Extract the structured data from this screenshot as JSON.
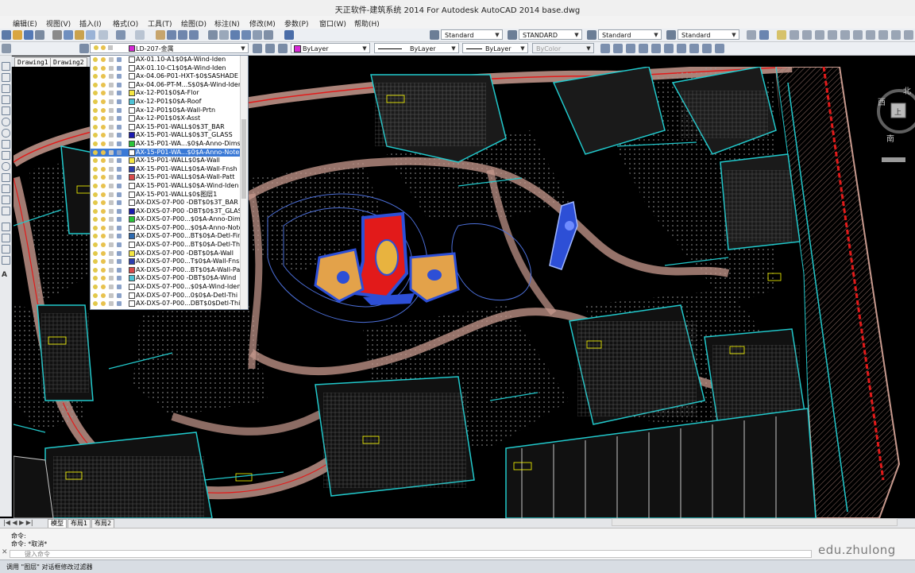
{
  "app": {
    "title": "天正软件-建筑系统 2014  For Autodesk AutoCAD 2014      base.dwg"
  },
  "menu": [
    "编辑(E)",
    "视图(V)",
    "插入(I)",
    "格式(O)",
    "工具(T)",
    "绘图(D)",
    "标注(N)",
    "修改(M)",
    "参数(P)",
    "窗口(W)",
    "帮助(H)"
  ],
  "styles": {
    "text_style": "Standard",
    "dim_style": "STANDARD",
    "table_style": "Standard",
    "multileader_style": "Standard"
  },
  "properties": {
    "current_layer": "LD-207-金属",
    "color": "ByLayer",
    "linetype": "ByLayer",
    "lineweight": "ByLayer",
    "plot_style": "ByColor"
  },
  "doc_tabs": [
    "Drawing1",
    "Drawing2"
  ],
  "layers": [
    {
      "name": "AX-01.10-A1$0$A-Wind-Iden",
      "swatch": "#ffffff"
    },
    {
      "name": "AX-01.10-C1$0$A-Wind-Iden",
      "swatch": "#ffffff"
    },
    {
      "name": "Ax-04.06-P01-HXT-$0$SASHADE",
      "swatch": "#ffffff"
    },
    {
      "name": "Ax-04.06-PT-M...S$0$A-Wind-Iden",
      "swatch": "#ffffff"
    },
    {
      "name": "Ax-12-P01$0$A-Flor",
      "swatch": "#f5e642"
    },
    {
      "name": "Ax-12-P01$0$A-Roof",
      "swatch": "#4ec3d6"
    },
    {
      "name": "Ax-12-P01$0$A-Wall-Prtn",
      "swatch": "#ffffff"
    },
    {
      "name": "Ax-12-P01$0$X-Asst",
      "swatch": "#ffffff"
    },
    {
      "name": "AX-15-P01-WALL$0$3T_BAR",
      "swatch": "#ffffff"
    },
    {
      "name": "AX-15-P01-WALL$0$3T_GLASS",
      "swatch": "#1a1ab0"
    },
    {
      "name": "AX-15-P01-WA...$0$A-Anno-Dims",
      "swatch": "#2ac43a"
    },
    {
      "name": "AX-15-P01-WA...$0$A-Anno-Note",
      "swatch": "#ffffff",
      "selected": true
    },
    {
      "name": "AX-15-P01-WALL$0$A-Wall",
      "swatch": "#f5e642"
    },
    {
      "name": "AX-15-P01-WALL$0$A-Wall-Fnsh",
      "swatch": "#2d3fb0"
    },
    {
      "name": "AX-15-P01-WALL$0$A-Wall-Patt",
      "swatch": "#d94a4a"
    },
    {
      "name": "AX-15-P01-WALL$0$A-Wind-Iden",
      "swatch": "#ffffff"
    },
    {
      "name": "AX-15-P01-WALL$0$图层1",
      "swatch": "#ffffff"
    },
    {
      "name": "AX-DXS-07-P00 -DBT$0$3T_BAR",
      "swatch": "#ffffff"
    },
    {
      "name": "AX-DXS-07-P00 -DBT$0$3T_GLASS",
      "swatch": "#1a1ab0"
    },
    {
      "name": "AX-DXS-07-P00...$0$A-Anno-Dims",
      "swatch": "#2ac43a"
    },
    {
      "name": "AX-DXS-07-P00...$0$A-Anno-Note",
      "swatch": "#ffffff"
    },
    {
      "name": "AX-DXS-07-P00...BT$0$A-Detl-Fin",
      "swatch": "#2d6ab0"
    },
    {
      "name": "AX-DXS-07-P00...BT$0$A-Detl-Thi",
      "swatch": "#ffffff"
    },
    {
      "name": "AX-DXS-07-P00 -DBT$0$A-Wall",
      "swatch": "#f5e642"
    },
    {
      "name": "AX-DXS-07-P00...T$0$A-Wall-Fnsh",
      "swatch": "#2d3fb0"
    },
    {
      "name": "AX-DXS-07-P00...BT$0$A-Wall-Pa",
      "swatch": "#d94a4a"
    },
    {
      "name": "AX-DXS-07-P00 -DBT$0$A-Wind",
      "swatch": "#4ec3d6"
    },
    {
      "name": "AX-DXS-07-P00...$0$A-Wind-Iden",
      "swatch": "#ffffff"
    },
    {
      "name": "AX-DXS-07-P00...0$0$A-Detl-Thi",
      "swatch": "#ffffff"
    },
    {
      "name": "AX-DXS-07-P00...DBT$0$Detl-Thi",
      "swatch": "#ffffff"
    }
  ],
  "layout_tabs": [
    "模型",
    "布局1",
    "布局2"
  ],
  "command": {
    "line1": "命令:",
    "line2": "命令: *取消*",
    "prompt": "键入命令"
  },
  "status": "调用 \"图层\" 对话框修改过滤器",
  "watermark": "edu.zhulong",
  "navcube": {
    "north": "北",
    "west": "西",
    "south": "南",
    "top": "上"
  },
  "colors": {
    "background": "#000000",
    "road_salmon": "#c89a8e",
    "cyan": "#21c9cc",
    "yellow": "#ffff00",
    "red": "#e21a1a",
    "pool_blue": "#2d4fd6",
    "pool_orange": "#e3a24a",
    "selection": "#3a79d6"
  }
}
